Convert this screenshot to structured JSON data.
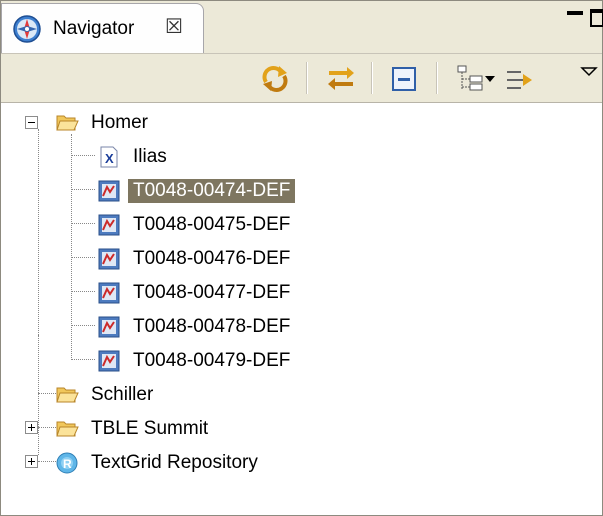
{
  "view": {
    "tab_title": "Navigator",
    "tab_icon": "compass-icon",
    "close_glyph": "☒"
  },
  "window_controls": [
    "minimize-icon",
    "maximize-icon"
  ],
  "toolbar": {
    "buttons": [
      {
        "name": "sync-icon"
      },
      {
        "name": "link-with-editor-icon"
      },
      {
        "name": "collapse-all-icon"
      },
      {
        "name": "tree-layout-icon"
      },
      {
        "name": "dropdown-arrow-icon"
      },
      {
        "name": "filter-icon"
      },
      {
        "name": "view-menu-icon"
      }
    ]
  },
  "tree": {
    "items": [
      {
        "label": "Homer",
        "icon": "open-folder-icon",
        "expanded": true
      },
      {
        "label": "Ilias",
        "icon": "xml-file-icon"
      },
      {
        "label": "T0048-00474-DEF",
        "icon": "image-file-icon",
        "selected": true
      },
      {
        "label": "T0048-00475-DEF",
        "icon": "image-file-icon"
      },
      {
        "label": "T0048-00476-DEF",
        "icon": "image-file-icon"
      },
      {
        "label": "T0048-00477-DEF",
        "icon": "image-file-icon"
      },
      {
        "label": "T0048-00478-DEF",
        "icon": "image-file-icon"
      },
      {
        "label": "T0048-00479-DEF",
        "icon": "image-file-icon"
      },
      {
        "label": "Schiller",
        "icon": "open-folder-icon"
      },
      {
        "label": "TBLE Summit",
        "icon": "open-folder-icon",
        "expanded": false
      },
      {
        "label": "TextGrid Repository",
        "icon": "repository-icon",
        "expanded": false
      }
    ]
  },
  "colors": {
    "selection": "#7e7660",
    "chrome": "#ece9d8",
    "tree_background": "#ffffff"
  }
}
